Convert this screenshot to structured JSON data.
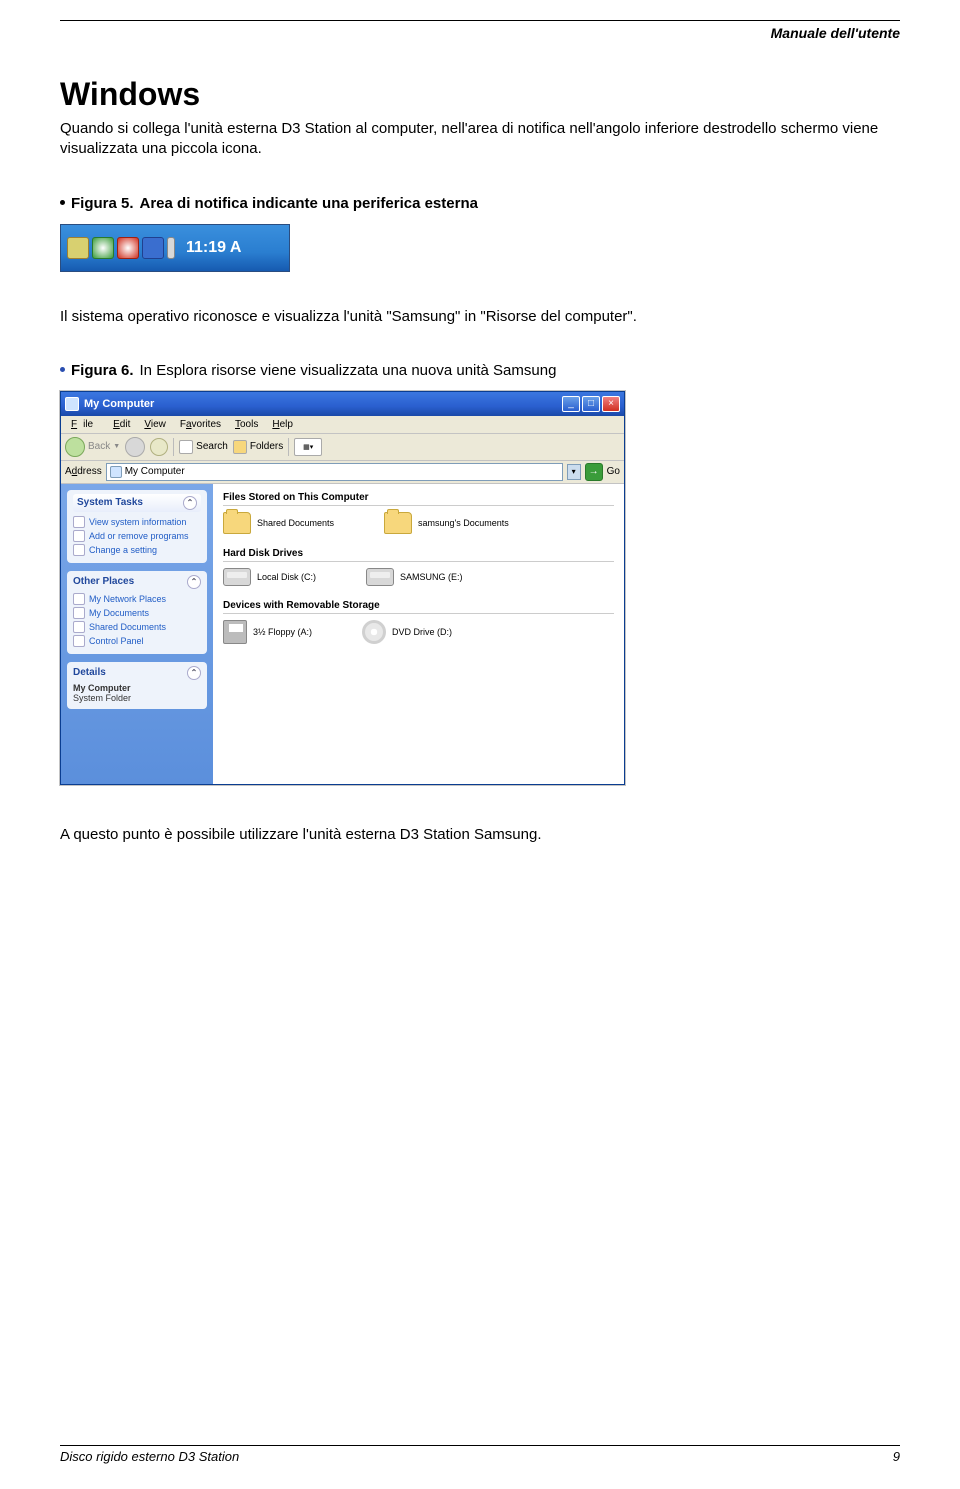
{
  "header": {
    "manual_title": "Manuale dell'utente"
  },
  "section": {
    "title": "Windows",
    "intro": "Quando si collega l'unità esterna D3 Station al computer, nell'area di notifica nell'angolo inferiore destrodello schermo viene visualizzata una piccola icona."
  },
  "figure5": {
    "label": "Figura 5.",
    "caption": "Area di notifica indicante una periferica esterna",
    "tray_time": "11:19 A"
  },
  "midtext": "Il sistema operativo riconosce e visualizza l'unità \"Samsung\" in \"Risorse del computer\".",
  "figure6": {
    "label": "Figura 6.",
    "caption": "In Esplora risorse viene visualizzata una nuova unità Samsung"
  },
  "explorer": {
    "title": "My Computer",
    "menus": {
      "file": "File",
      "edit": "Edit",
      "view": "View",
      "favorites": "Favorites",
      "tools": "Tools",
      "help": "Help"
    },
    "toolbar": {
      "back": "Back",
      "search": "Search",
      "folders": "Folders"
    },
    "address_label": "Address",
    "address_value": "My Computer",
    "go_label": "Go",
    "sidebar": {
      "system_tasks": {
        "title": "System Tasks",
        "items": [
          "View system information",
          "Add or remove programs",
          "Change a setting"
        ]
      },
      "other_places": {
        "title": "Other Places",
        "items": [
          "My Network Places",
          "My Documents",
          "Shared Documents",
          "Control Panel"
        ]
      },
      "details": {
        "title": "Details",
        "line1": "My Computer",
        "line2": "System Folder"
      }
    },
    "sections": {
      "files_stored": "Files Stored on This Computer",
      "hard_disk": "Hard Disk Drives",
      "removable": "Devices with Removable Storage"
    },
    "drives": {
      "shared_docs": "Shared Documents",
      "user_docs": "samsung's Documents",
      "local_c": "Local Disk (C:)",
      "samsung_e": "SAMSUNG (E:)",
      "floppy": "3½ Floppy (A:)",
      "dvd": "DVD Drive (D:)"
    }
  },
  "closing": "A questo punto è possibile utilizzare l'unità esterna D3 Station Samsung.",
  "footer": {
    "left": "Disco rigido esterno D3 Station",
    "right": "9"
  }
}
